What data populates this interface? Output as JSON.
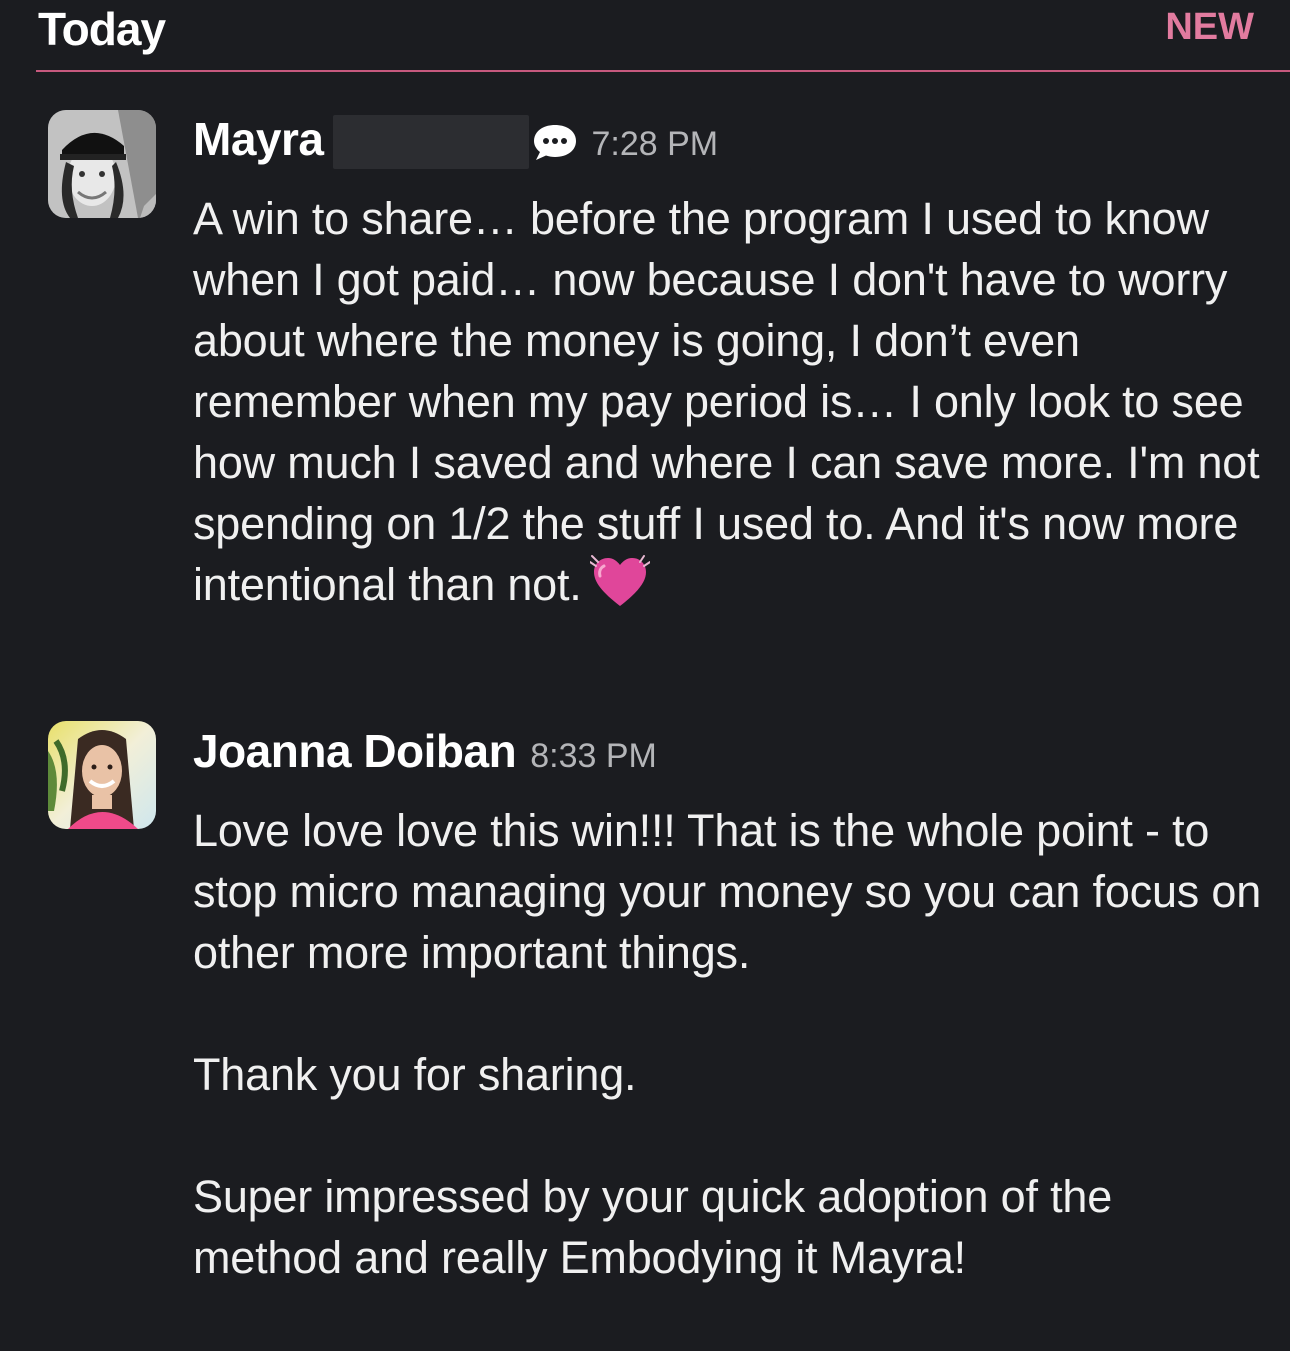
{
  "header": {
    "title": "Today",
    "new_label": "NEW"
  },
  "messages": [
    {
      "author": "Mayra",
      "time": "7:28 PM",
      "body": [
        "A win to share… before the program I used to know when I got paid… now because I don't have to worry about where the money is going, I don’t even remember when my pay period is… I only look to see how much I saved and where I can save more. I'm not spending on 1/2 the stuff I used to. And it's now more intentional than not."
      ],
      "emoji": "heart-icon"
    },
    {
      "author": "Joanna Doiban",
      "time": "8:33 PM",
      "body": [
        "Love love love this win!!! That is the whole point - to stop micro managing your money so you can focus on other more important things.",
        "Thank you for sharing.",
        "Super impressed by your quick adoption of the method and really Embodying it Mayra!"
      ]
    }
  ],
  "colors": {
    "background": "#1b1c20",
    "divider": "#c7597e",
    "new_badge": "#e27b9f",
    "timestamp": "#b4b5b8"
  }
}
